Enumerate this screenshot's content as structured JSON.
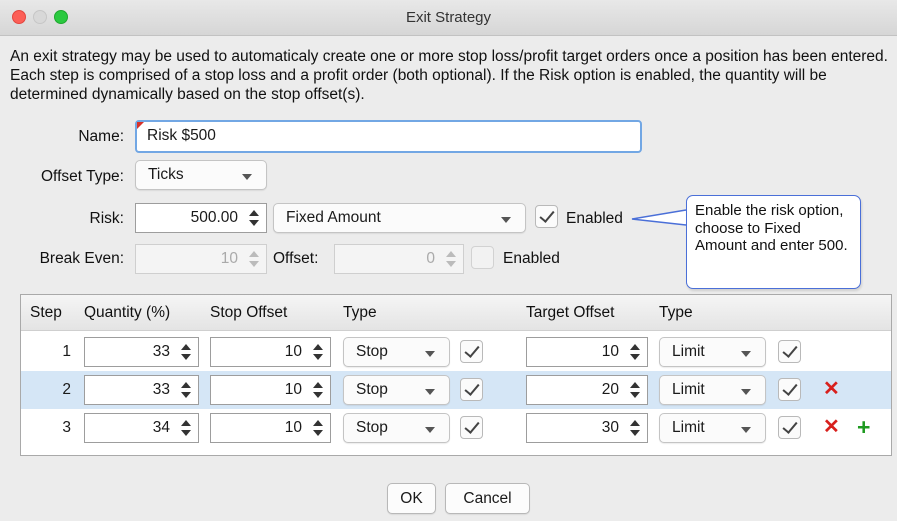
{
  "window": {
    "title": "Exit Strategy"
  },
  "intro_text": "An exit strategy may be used to automaticaly create one or more stop loss/profit target orders once a position has been entered.  Each step is comprised of a stop loss and a profit order (both optional). If the Risk option is enabled, the quantity will be determined dynamically based on the stop offset(s).",
  "form": {
    "name_label": "Name:",
    "name_value": "Risk $500",
    "offset_type_label": "Offset Type:",
    "offset_type_value": "Ticks",
    "risk_label": "Risk:",
    "risk_value": "500.00",
    "risk_mode_value": "Fixed Amount",
    "risk_enabled_label": "Enabled",
    "risk_enabled": true,
    "break_even_label": "Break Even:",
    "break_even_value": "10",
    "offset_label": "Offset:",
    "offset_value": "0",
    "break_even_enabled_label": "Enabled",
    "break_even_enabled": false
  },
  "callout": {
    "text": "Enable the risk option, choose to Fixed Amount and enter 500."
  },
  "steps_table": {
    "headers": {
      "step": "Step",
      "quantity": "Quantity (%)",
      "stop_offset": "Stop Offset",
      "stop_type": "Type",
      "target_offset": "Target Offset",
      "target_type": "Type"
    },
    "rows": [
      {
        "step": "1",
        "quantity": "33",
        "stop_offset": "10",
        "stop_type": "Stop",
        "stop_enabled": true,
        "target_offset": "10",
        "target_type": "Limit",
        "target_enabled": true
      },
      {
        "step": "2",
        "quantity": "33",
        "stop_offset": "10",
        "stop_type": "Stop",
        "stop_enabled": true,
        "target_offset": "20",
        "target_type": "Limit",
        "target_enabled": true,
        "delete_icon": "✕"
      },
      {
        "step": "3",
        "quantity": "34",
        "stop_offset": "10",
        "stop_type": "Stop",
        "stop_enabled": true,
        "target_offset": "30",
        "target_type": "Limit",
        "target_enabled": true,
        "delete_icon": "✕",
        "add_icon": "+"
      }
    ]
  },
  "buttons": {
    "ok": "OK",
    "cancel": "Cancel"
  },
  "colors": {
    "accent": "#72a7e4",
    "selected_row": "#d5e6f6",
    "delete": "#d8201d",
    "add": "#1e9a20",
    "callout_border": "#4a6fd8"
  }
}
